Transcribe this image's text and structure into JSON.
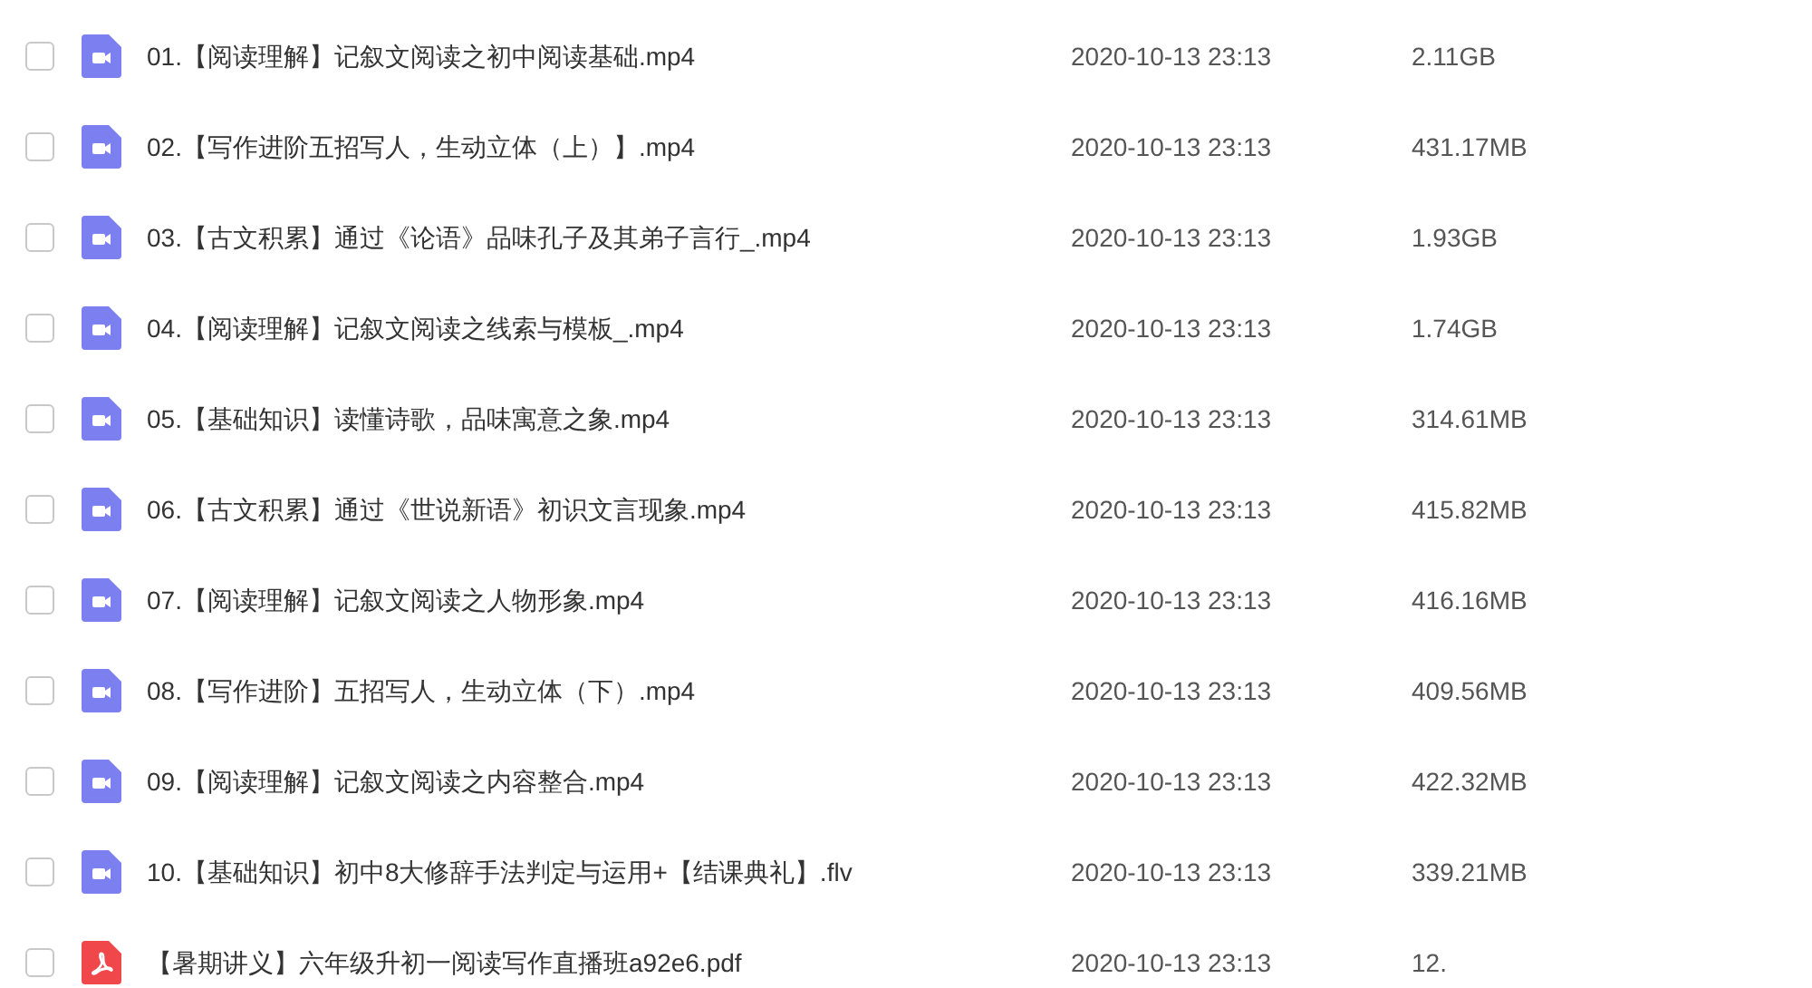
{
  "files": [
    {
      "kind": "video",
      "checked": false,
      "name": "01.【阅读理解】记叙文阅读之初中阅读基础.mp4",
      "modified": "2020-10-13 23:13",
      "size": "2.11GB"
    },
    {
      "kind": "video",
      "checked": false,
      "name": "02.【写作进阶五招写人，生动立体（上）】.mp4",
      "modified": "2020-10-13 23:13",
      "size": "431.17MB"
    },
    {
      "kind": "video",
      "checked": false,
      "name": "03.【古文积累】通过《论语》品味孔子及其弟子言行_.mp4",
      "modified": "2020-10-13 23:13",
      "size": "1.93GB"
    },
    {
      "kind": "video",
      "checked": false,
      "name": "04.【阅读理解】记叙文阅读之线索与模板_.mp4",
      "modified": "2020-10-13 23:13",
      "size": "1.74GB"
    },
    {
      "kind": "video",
      "checked": false,
      "name": "05.【基础知识】读懂诗歌，品味寓意之象.mp4",
      "modified": "2020-10-13 23:13",
      "size": "314.61MB"
    },
    {
      "kind": "video",
      "checked": false,
      "name": "06.【古文积累】通过《世说新语》初识文言现象.mp4",
      "modified": "2020-10-13 23:13",
      "size": "415.82MB"
    },
    {
      "kind": "video",
      "checked": false,
      "name": "07.【阅读理解】记叙文阅读之人物形象.mp4",
      "modified": "2020-10-13 23:13",
      "size": "416.16MB"
    },
    {
      "kind": "video",
      "checked": false,
      "name": "08.【写作进阶】五招写人，生动立体（下）.mp4",
      "modified": "2020-10-13 23:13",
      "size": "409.56MB"
    },
    {
      "kind": "video",
      "checked": false,
      "name": "09.【阅读理解】记叙文阅读之内容整合.mp4",
      "modified": "2020-10-13 23:13",
      "size": "422.32MB"
    },
    {
      "kind": "video",
      "checked": false,
      "name": "10.【基础知识】初中8大修辞手法判定与运用+【结课典礼】.flv",
      "modified": "2020-10-13 23:13",
      "size": "339.21MB"
    },
    {
      "kind": "pdf",
      "checked": false,
      "name": "【暑期讲义】六年级升初一阅读写作直播班a92e6.pdf",
      "modified": "2020-10-13 23:13",
      "size": "12."
    }
  ]
}
